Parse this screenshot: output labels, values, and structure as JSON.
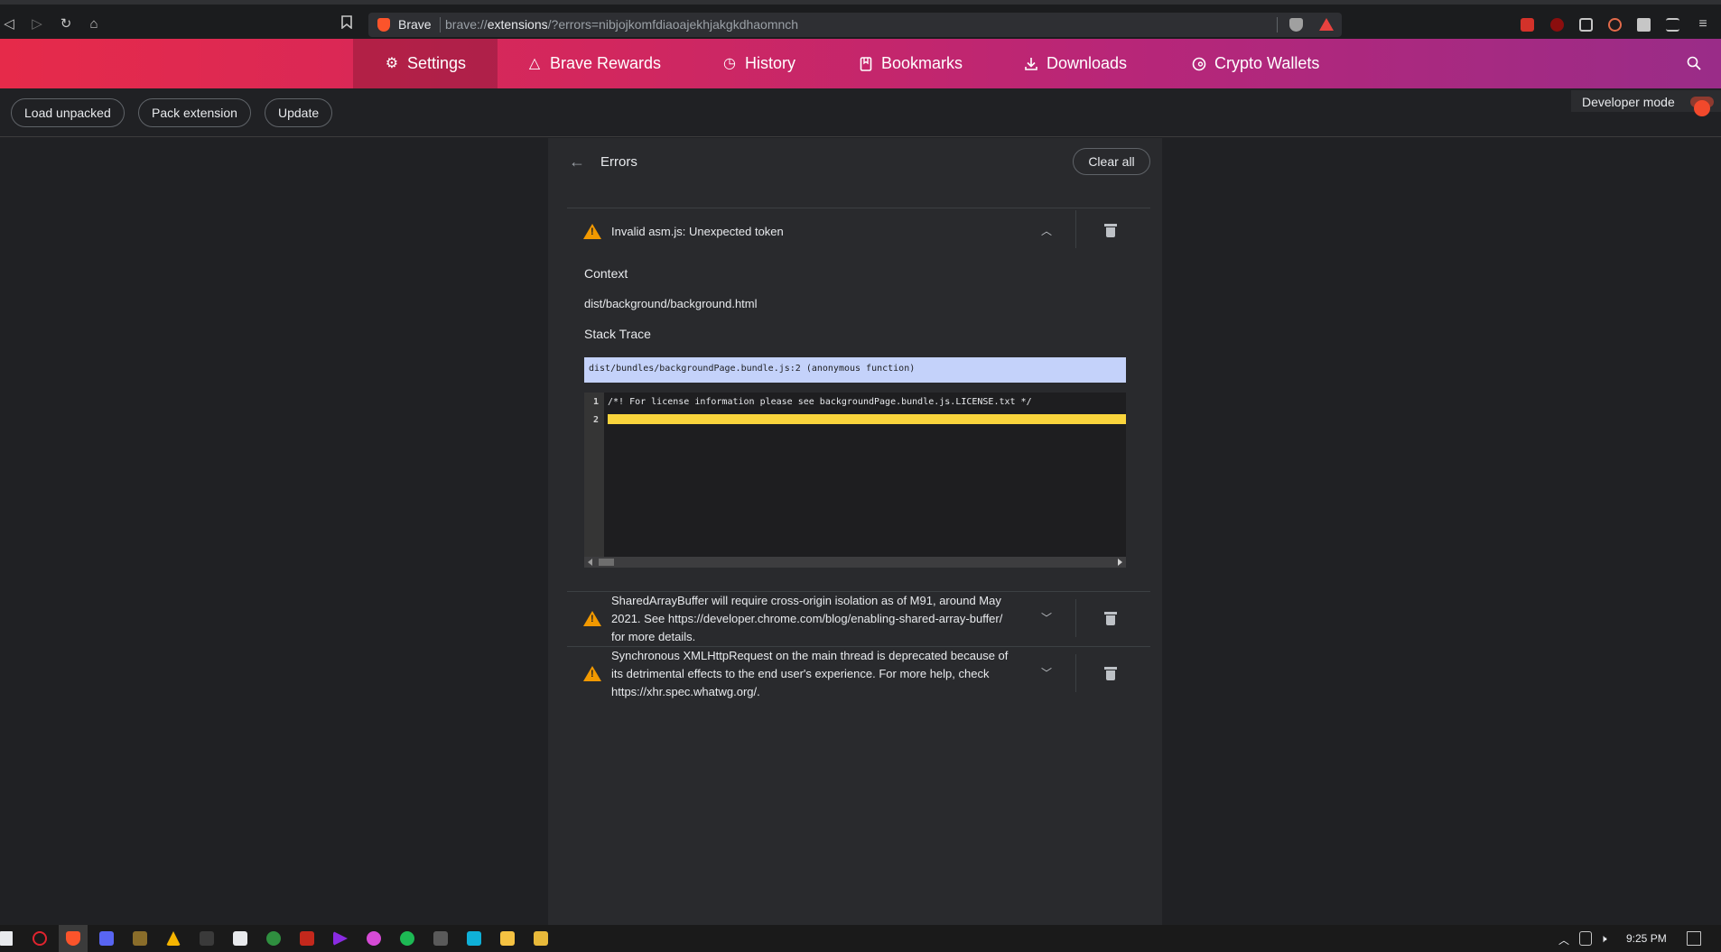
{
  "browser": {
    "brand": "Brave",
    "url_prefix": "brave://",
    "url_host": "extensions",
    "url_rest": "/?errors=nibjojkomfdiaoajekhjakgkdhaomnch"
  },
  "nav": {
    "tabs": [
      {
        "label": "Settings",
        "icon": "gear-icon"
      },
      {
        "label": "Brave Rewards",
        "icon": "rewards-triangle-icon"
      },
      {
        "label": "History",
        "icon": "history-icon"
      },
      {
        "label": "Bookmarks",
        "icon": "bookmark-icon"
      },
      {
        "label": "Downloads",
        "icon": "download-icon"
      },
      {
        "label": "Crypto Wallets",
        "icon": "wallet-icon"
      }
    ]
  },
  "toolbar": {
    "load_unpacked": "Load unpacked",
    "pack_extension": "Pack extension",
    "update": "Update",
    "developer_mode": "Developer mode"
  },
  "errors_page": {
    "title": "Errors",
    "clear_all": "Clear all",
    "context_label": "Context",
    "context_value": "dist/background/background.html",
    "stack_trace_label": "Stack Trace",
    "stack_frame": "dist/bundles/backgroundPage.bundle.js:2 (anonymous function)",
    "code": {
      "line_numbers": [
        "1",
        "2"
      ],
      "lines": [
        "/*! For license information please see backgroundPage.bundle.js.LICENSE.txt */",
        ""
      ]
    },
    "errors": [
      {
        "message": "Invalid asm.js: Unexpected token"
      },
      {
        "message": "SharedArrayBuffer will require cross-origin isolation as of M91, around May 2021. See https://developer.chrome.com/blog/enabling-shared-array-buffer/ for more details."
      },
      {
        "message": "Synchronous XMLHttpRequest on the main thread is deprecated because of its detrimental effects to the end user's experience. For more help, check https://xhr.spec.whatwg.org/."
      }
    ]
  },
  "taskbar": {
    "time": "9:25 PM"
  },
  "colors": {
    "warning": "#f29900",
    "nav_gradient_start": "#e62a4a",
    "nav_gradient_end": "#9a2c88",
    "highlight_line": "#f9d43c",
    "stack_frame_bg": "#c4d2fa",
    "toggle_on": "#f2492c"
  }
}
